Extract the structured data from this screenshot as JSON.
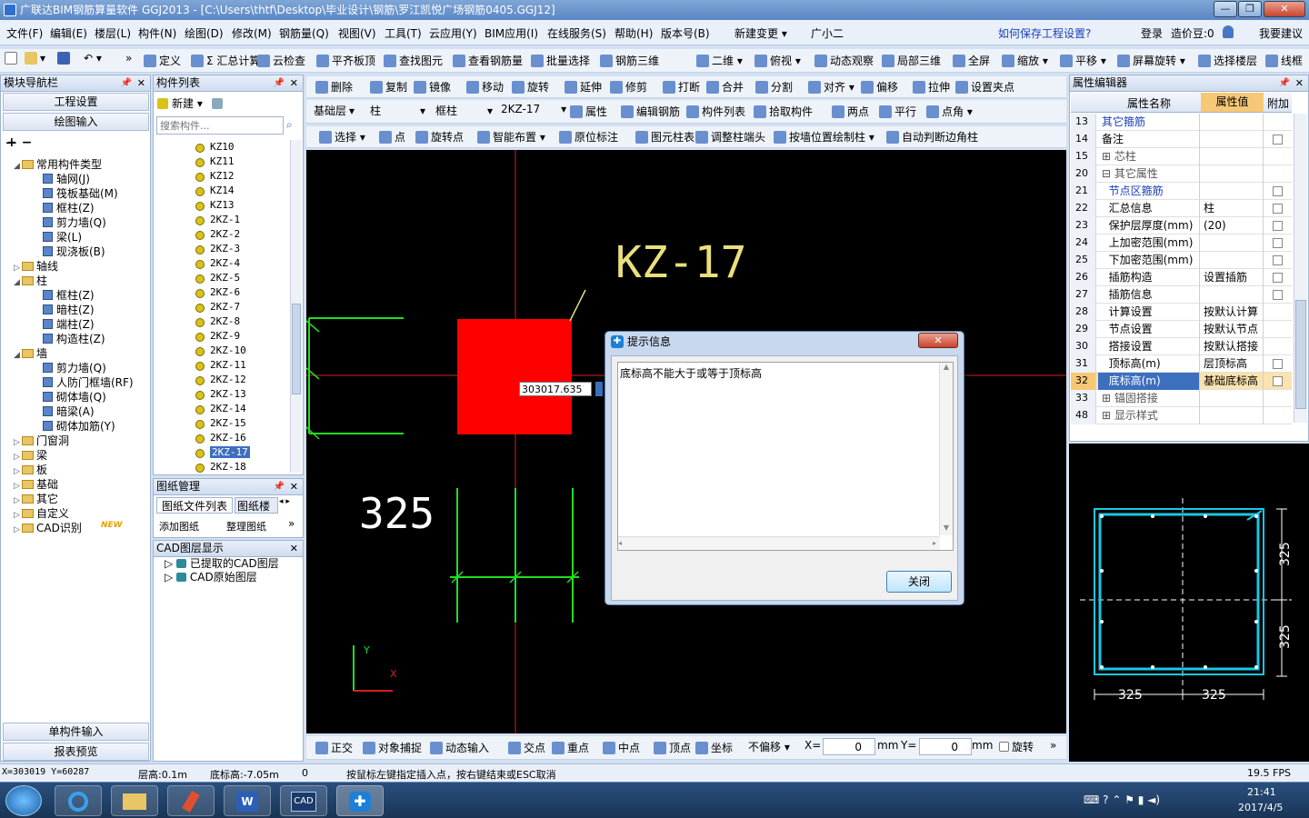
{
  "window": {
    "title": "广联达BIM钢筋算量软件 GGJ2013 - [C:\\Users\\thtf\\Desktop\\毕业设计\\钢筋\\罗江凯悦广场钢筋0405.GGJ12]"
  },
  "menu": [
    "文件(F)",
    "编辑(E)",
    "楼层(L)",
    "构件(N)",
    "绘图(D)",
    "修改(M)",
    "钢筋量(Q)",
    "视图(V)",
    "工具(T)",
    "云应用(Y)",
    "BIM应用(I)",
    "在线服务(S)",
    "帮助(H)",
    "版本号(B)",
    "新建变更 ▾",
    "广小二"
  ],
  "menu_right": {
    "help_link": "如何保存工程设置?",
    "login": "登录",
    "coins": "造价豆:0",
    "suggest": "我要建议"
  },
  "toolbar1": [
    "定义",
    "Σ 汇总计算",
    "云检查",
    "平齐板顶",
    "查找图元",
    "查看钢筋量",
    "批量选择",
    "钢筋三维",
    "二维 ▾",
    "俯视 ▾",
    "动态观察",
    "局部三维",
    "全屏",
    "缩放 ▾",
    "平移 ▾",
    "屏幕旋转 ▾",
    "选择楼层",
    "线框"
  ],
  "toolbar2": [
    "删除",
    "复制",
    "镜像",
    "移动",
    "旋转",
    "延伸",
    "修剪",
    "打断",
    "合并",
    "分割",
    "对齐 ▾",
    "偏移",
    "拉伸",
    "设置夹点"
  ],
  "toolbar3": {
    "floor": "基础层",
    "type": "柱",
    "subtype": "框柱",
    "component": "2KZ-17",
    "items": [
      "属性",
      "编辑钢筋",
      "构件列表",
      "拾取构件",
      "两点",
      "平行",
      "点角 ▾"
    ]
  },
  "toolbar4": [
    "选择 ▾",
    "点",
    "旋转点",
    "智能布置 ▾",
    "原位标注",
    "图元柱表",
    "调整柱端头",
    "按墙位置绘制柱 ▾",
    "自动判断边角柱"
  ],
  "nav": {
    "title": "模块导航栏",
    "btn_project": "工程设置",
    "btn_draw": "绘图输入",
    "btn_single": "单构件输入",
    "btn_report": "报表预览",
    "tree": [
      {
        "label": "常用构件类型",
        "type": "folder",
        "exp": "◢",
        "indent": 0
      },
      {
        "label": "轴网(J)",
        "type": "comp",
        "indent": 1
      },
      {
        "label": "筏板基础(M)",
        "type": "comp",
        "indent": 1
      },
      {
        "label": "框柱(Z)",
        "type": "comp",
        "indent": 1
      },
      {
        "label": "剪力墙(Q)",
        "type": "comp",
        "indent": 1
      },
      {
        "label": "梁(L)",
        "type": "comp",
        "indent": 1
      },
      {
        "label": "现浇板(B)",
        "type": "comp",
        "indent": 1
      },
      {
        "label": "轴线",
        "type": "folder",
        "exp": "▷",
        "indent": 0
      },
      {
        "label": "柱",
        "type": "folder",
        "exp": "◢",
        "indent": 0
      },
      {
        "label": "框柱(Z)",
        "type": "comp",
        "indent": 1
      },
      {
        "label": "暗柱(Z)",
        "type": "comp",
        "indent": 1
      },
      {
        "label": "端柱(Z)",
        "type": "comp",
        "indent": 1
      },
      {
        "label": "构造柱(Z)",
        "type": "comp",
        "indent": 1
      },
      {
        "label": "墙",
        "type": "folder",
        "exp": "◢",
        "indent": 0
      },
      {
        "label": "剪力墙(Q)",
        "type": "comp",
        "indent": 1
      },
      {
        "label": "人防门框墙(RF)",
        "type": "comp",
        "indent": 1
      },
      {
        "label": "砌体墙(Q)",
        "type": "comp",
        "indent": 1
      },
      {
        "label": "暗梁(A)",
        "type": "comp",
        "indent": 1
      },
      {
        "label": "砌体加筋(Y)",
        "type": "comp",
        "indent": 1
      },
      {
        "label": "门窗洞",
        "type": "folder",
        "exp": "▷",
        "indent": 0
      },
      {
        "label": "梁",
        "type": "folder",
        "exp": "▷",
        "indent": 0
      },
      {
        "label": "板",
        "type": "folder",
        "exp": "▷",
        "indent": 0
      },
      {
        "label": "基础",
        "type": "folder",
        "exp": "▷",
        "indent": 0
      },
      {
        "label": "其它",
        "type": "folder",
        "exp": "▷",
        "indent": 0
      },
      {
        "label": "自定义",
        "type": "folder",
        "exp": "▷",
        "indent": 0
      },
      {
        "label": "CAD识别",
        "type": "folder",
        "exp": "▷",
        "indent": 0
      }
    ],
    "new_badge": "NEW"
  },
  "complist": {
    "title": "构件列表",
    "new_btn": "新建 ▾",
    "search_placeholder": "搜索构件...",
    "items": [
      "KZ10",
      "KZ11",
      "KZ12",
      "KZ14",
      "KZ13",
      "2KZ-1",
      "2KZ-2",
      "2KZ-3",
      "2KZ-4",
      "2KZ-5",
      "2KZ-6",
      "2KZ-7",
      "2KZ-8",
      "2KZ-9",
      "2KZ-10",
      "2KZ-11",
      "2KZ-12",
      "2KZ-13",
      "2KZ-14",
      "2KZ-15",
      "2KZ-16",
      "2KZ-17",
      "2KZ-18"
    ],
    "selected_index": 21
  },
  "drawings": {
    "title": "图纸管理",
    "tab1": "图纸文件列表",
    "tab2": "图纸楼",
    "add": "添加图纸",
    "arrange": "整理图纸"
  },
  "cadlayers": {
    "title": "CAD图层显示",
    "items": [
      "已提取的CAD图层",
      "CAD原始图层"
    ]
  },
  "canvas": {
    "label": "KZ-17",
    "dim": "325",
    "coord_input": "303017.635",
    "axis_y": "Y",
    "axis_x": "X",
    "colors": {
      "column": "#ff0000",
      "grid": "#e02020",
      "wall": "#22dd22",
      "label": "#e8e07a"
    }
  },
  "props": {
    "title": "属性编辑器",
    "col_name": "属性名称",
    "col_value": "属性值",
    "col_extra": "附加",
    "rows": [
      {
        "n": "13",
        "name": "其它箍筋",
        "value": "",
        "blue": true,
        "ck": false
      },
      {
        "n": "14",
        "name": "备注",
        "value": "",
        "ck": true
      },
      {
        "n": "15",
        "name": "⊞ 芯柱",
        "value": "",
        "ck": false,
        "gray": true
      },
      {
        "n": "20",
        "name": "⊟ 其它属性",
        "value": "",
        "ck": false,
        "gray": true
      },
      {
        "n": "21",
        "name": "  节点区箍筋",
        "value": "",
        "blue": true,
        "ck": true
      },
      {
        "n": "22",
        "name": "  汇总信息",
        "value": "柱",
        "ck": true
      },
      {
        "n": "23",
        "name": "  保护层厚度(mm)",
        "value": "(20)",
        "ck": true
      },
      {
        "n": "24",
        "name": "  上加密范围(mm)",
        "value": "",
        "ck": true
      },
      {
        "n": "25",
        "name": "  下加密范围(mm)",
        "value": "",
        "ck": true
      },
      {
        "n": "26",
        "name": "  插筋构造",
        "value": "设置插筋",
        "ck": true
      },
      {
        "n": "27",
        "name": "  插筋信息",
        "value": "",
        "ck": true
      },
      {
        "n": "28",
        "name": "  计算设置",
        "value": "按默认计算",
        "ck": false
      },
      {
        "n": "29",
        "name": "  节点设置",
        "value": "按默认节点",
        "ck": false
      },
      {
        "n": "30",
        "name": "  搭接设置",
        "value": "按默认搭接",
        "ck": false
      },
      {
        "n": "31",
        "name": "  顶标高(m)",
        "value": "层顶标高",
        "ck": true
      },
      {
        "n": "32",
        "name": "  底标高(m)",
        "value": "基础底标高",
        "ck": true,
        "sel": true
      },
      {
        "n": "33",
        "name": "⊞ 锚固搭接",
        "value": "",
        "ck": false,
        "gray": true
      },
      {
        "n": "48",
        "name": "⊞ 显示样式",
        "value": "",
        "ck": false,
        "gray": true
      }
    ]
  },
  "preview": {
    "dim_v1": "325",
    "dim_v2": "325",
    "dim_h1": "325",
    "dim_h2": "325",
    "colors": {
      "frame": "#19c8e6",
      "dims": "#ffffff"
    }
  },
  "dialog": {
    "title": "提示信息",
    "message": "底标高不能大于或等于顶标高",
    "close": "关闭"
  },
  "bottombar": {
    "items": [
      "正交",
      "对象捕捉",
      "动态输入",
      "交点",
      "重点",
      "中点",
      "顶点",
      "坐标"
    ],
    "offset_mode": "不偏移 ▾",
    "x_label": "X=",
    "x_value": "0",
    "y_label": "Y=",
    "y_value": "0",
    "unit": "mm",
    "rotate": "旋转"
  },
  "status": {
    "coords": "X=303019  Y=60287",
    "floor_height": "层高:0.1m",
    "bottom_elev": "底标高:-7.05m",
    "zero": "0",
    "hint": "按鼠标左键指定插入点，按右键结束或ESC取消",
    "fps": "19.5 FPS"
  },
  "taskbar": {
    "time": "21:41",
    "date": "2017/4/5"
  }
}
